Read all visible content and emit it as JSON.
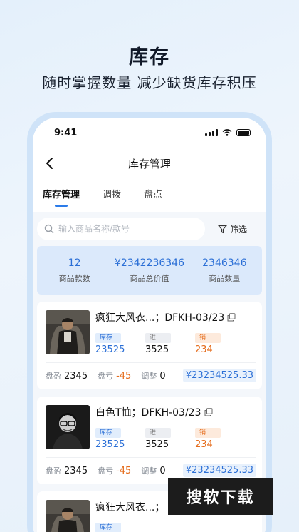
{
  "promo": {
    "title": "库存",
    "subtitle": "随时掌握数量 减少缺货库存积压"
  },
  "status_bar": {
    "time": "9:41"
  },
  "nav": {
    "title": "库存管理",
    "back_icon": "chevron-left-icon"
  },
  "tabs": [
    {
      "label": "库存管理",
      "active": true
    },
    {
      "label": "调拨",
      "active": false
    },
    {
      "label": "盘点",
      "active": false
    }
  ],
  "search": {
    "placeholder": "输入商品名称/款号",
    "value": ""
  },
  "filter": {
    "label": "筛选"
  },
  "summary": [
    {
      "value": "12",
      "label": "商品款数"
    },
    {
      "value": "¥2342236346",
      "label": "商品总价值"
    },
    {
      "value": "2346346",
      "label": "商品数量"
    }
  ],
  "cards": [
    {
      "name": "疯狂大风衣...；DFKH-03/23",
      "stock_tag": "库存",
      "stock": "23525",
      "in_tag": "进",
      "in": "3525",
      "out_tag": "销",
      "out": "234",
      "gain_label": "盘盈",
      "gain": "2345",
      "loss_label": "盘亏",
      "loss": "-45",
      "adjust_label": "调整",
      "adjust": "0",
      "amount": "¥23234525.33"
    },
    {
      "name": "白色T恤；DFKH-03/23",
      "stock_tag": "库存",
      "stock": "23525",
      "in_tag": "进",
      "in": "3525",
      "out_tag": "销",
      "out": "234",
      "gain_label": "盘盈",
      "gain": "2345",
      "loss_label": "盘亏",
      "loss": "-45",
      "adjust_label": "调整",
      "adjust": "0",
      "amount": "¥23234525.33"
    },
    {
      "name": "疯狂大风衣...；",
      "stock_tag": "库存"
    }
  ],
  "watermark": {
    "text": "搜软下载"
  },
  "colors": {
    "accent": "#2b7be9",
    "orange": "#e56c1c",
    "summary_bg": "#dbe9fb"
  }
}
